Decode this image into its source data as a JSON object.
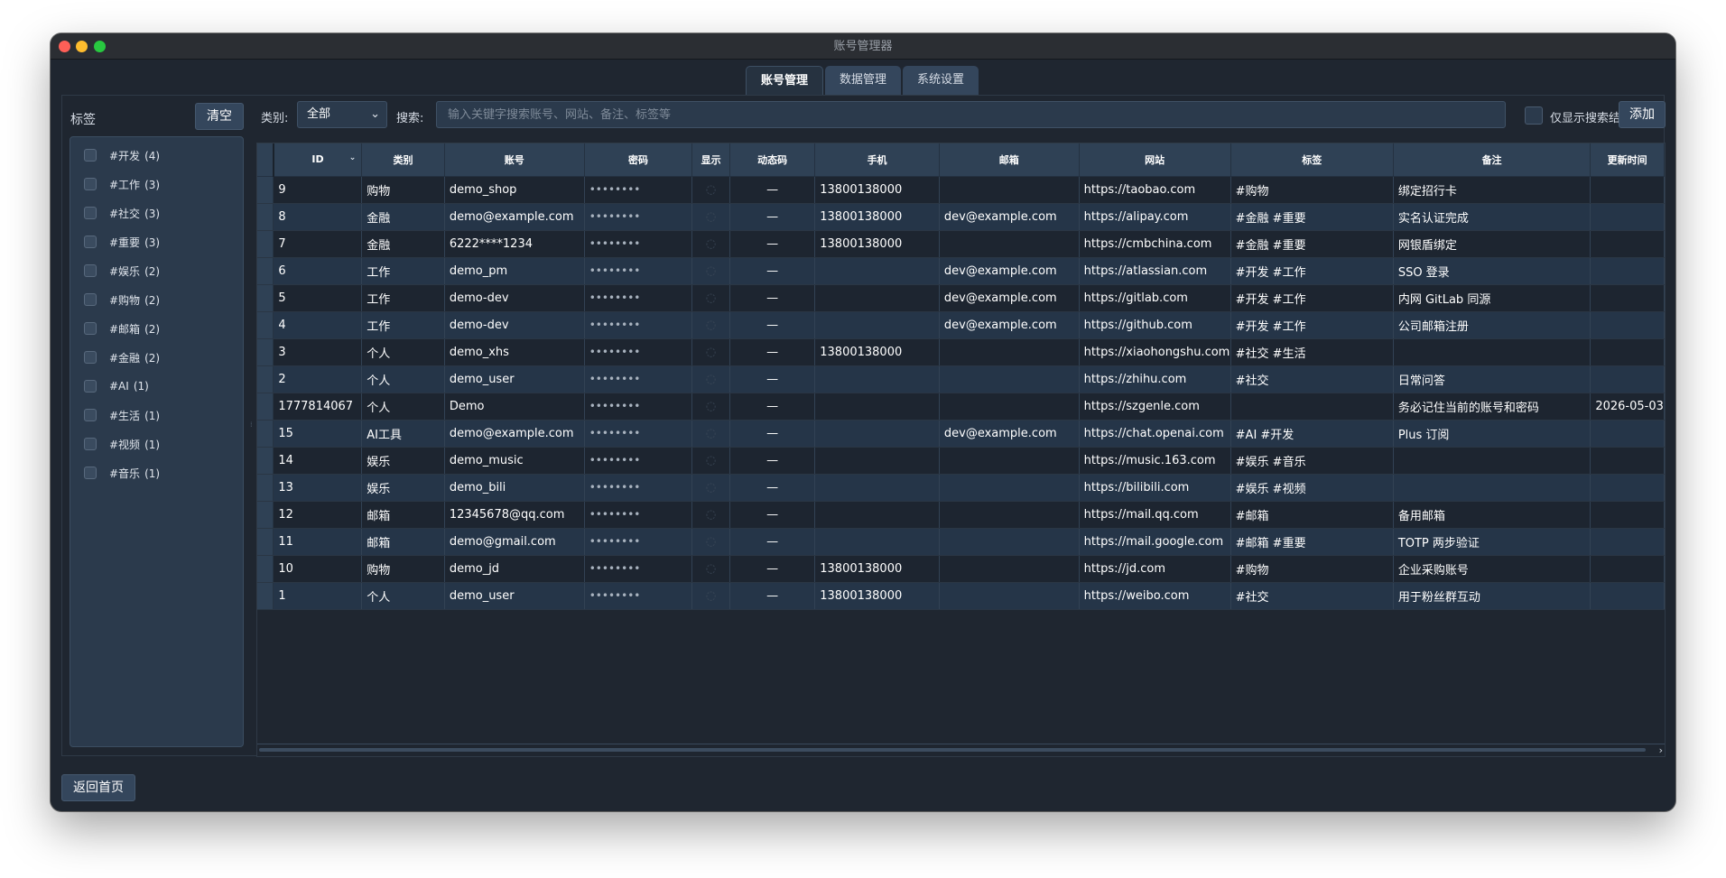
{
  "window": {
    "title": "账号管理器"
  },
  "tabs": [
    {
      "label": "账号管理",
      "active": true
    },
    {
      "label": "数据管理",
      "active": false
    },
    {
      "label": "系统设置",
      "active": false
    }
  ],
  "sidebar": {
    "title": "标签",
    "clear_label": "清空",
    "tags": [
      {
        "name": "#开发",
        "count": "(4)"
      },
      {
        "name": "#工作",
        "count": "(3)"
      },
      {
        "name": "#社交",
        "count": "(3)"
      },
      {
        "name": "#重要",
        "count": "(3)"
      },
      {
        "name": "#娱乐",
        "count": "(2)"
      },
      {
        "name": "#购物",
        "count": "(2)"
      },
      {
        "name": "#邮箱",
        "count": "(2)"
      },
      {
        "name": "#金融",
        "count": "(2)"
      },
      {
        "name": "#AI",
        "count": "(1)"
      },
      {
        "name": "#生活",
        "count": "(1)"
      },
      {
        "name": "#视频",
        "count": "(1)"
      },
      {
        "name": "#音乐",
        "count": "(1)"
      }
    ]
  },
  "toolbar": {
    "category_label": "类别:",
    "category_value": "全部",
    "search_label": "搜索:",
    "search_placeholder": "输入关键字搜索账号、网站、备注、标签等",
    "only_results_label": "仅显示搜索结果",
    "add_label": "添加"
  },
  "table": {
    "columns": [
      "ID",
      "类别",
      "账号",
      "密码",
      "显示",
      "动态码",
      "手机",
      "邮箱",
      "网站",
      "标签",
      "备注",
      "更新时间"
    ],
    "password_mask": "••••••••",
    "totp_placeholder": "—",
    "rows": [
      [
        "9",
        "购物",
        "demo_shop",
        "13800138000",
        "",
        "https://taobao.com",
        "#购物",
        "绑定招行卡",
        ""
      ],
      [
        "8",
        "金融",
        "demo@example.com",
        "13800138000",
        "dev@example.com",
        "https://alipay.com",
        "#金融  #重要",
        "实名认证完成",
        ""
      ],
      [
        "7",
        "金融",
        "6222****1234",
        "13800138000",
        "",
        "https://cmbchina.com",
        "#金融  #重要",
        "网银盾绑定",
        ""
      ],
      [
        "6",
        "工作",
        "demo_pm",
        "",
        "dev@example.com",
        "https://atlassian.com",
        "#开发  #工作",
        "SSO 登录",
        ""
      ],
      [
        "5",
        "工作",
        "demo-dev",
        "",
        "dev@example.com",
        "https://gitlab.com",
        "#开发  #工作",
        "内网 GitLab 同源",
        ""
      ],
      [
        "4",
        "工作",
        "demo-dev",
        "",
        "dev@example.com",
        "https://github.com",
        "#开发  #工作",
        "公司邮箱注册",
        ""
      ],
      [
        "3",
        "个人",
        "demo_xhs",
        "13800138000",
        "",
        "https://xiaohongshu.com",
        "#社交  #生活",
        "",
        ""
      ],
      [
        "2",
        "个人",
        "demo_user",
        "",
        "",
        "https://zhihu.com",
        "#社交",
        "日常问答",
        ""
      ],
      [
        "1777814067",
        "个人",
        "Demo",
        "",
        "",
        "https://szgenle.com",
        "",
        "务必记住当前的账号和密码",
        "2026-05-03"
      ],
      [
        "15",
        "AI工具",
        "demo@example.com",
        "",
        "dev@example.com",
        "https://chat.openai.com",
        "#AI  #开发",
        "Plus 订阅",
        ""
      ],
      [
        "14",
        "娱乐",
        "demo_music",
        "",
        "",
        "https://music.163.com",
        "#娱乐  #音乐",
        "",
        ""
      ],
      [
        "13",
        "娱乐",
        "demo_bili",
        "",
        "",
        "https://bilibili.com",
        "#娱乐  #视频",
        "",
        ""
      ],
      [
        "12",
        "邮箱",
        "12345678@qq.com",
        "",
        "",
        "https://mail.qq.com",
        "#邮箱",
        "备用邮箱",
        ""
      ],
      [
        "11",
        "邮箱",
        "demo@gmail.com",
        "",
        "",
        "https://mail.google.com",
        "#邮箱  #重要",
        "TOTP 两步验证",
        ""
      ],
      [
        "10",
        "购物",
        "demo_jd",
        "13800138000",
        "",
        "https://jd.com",
        "#购物",
        "企业采购账号",
        ""
      ],
      [
        "1",
        "个人",
        "demo_user",
        "13800138000",
        "",
        "https://weibo.com",
        "#社交",
        "用于粉丝群互动",
        ""
      ]
    ]
  },
  "footer": {
    "home_label": "返回首页"
  },
  "colors": {
    "background": "#1f2630",
    "header": "#2f4155",
    "row_alt": "#253548",
    "button": "#34465c"
  }
}
